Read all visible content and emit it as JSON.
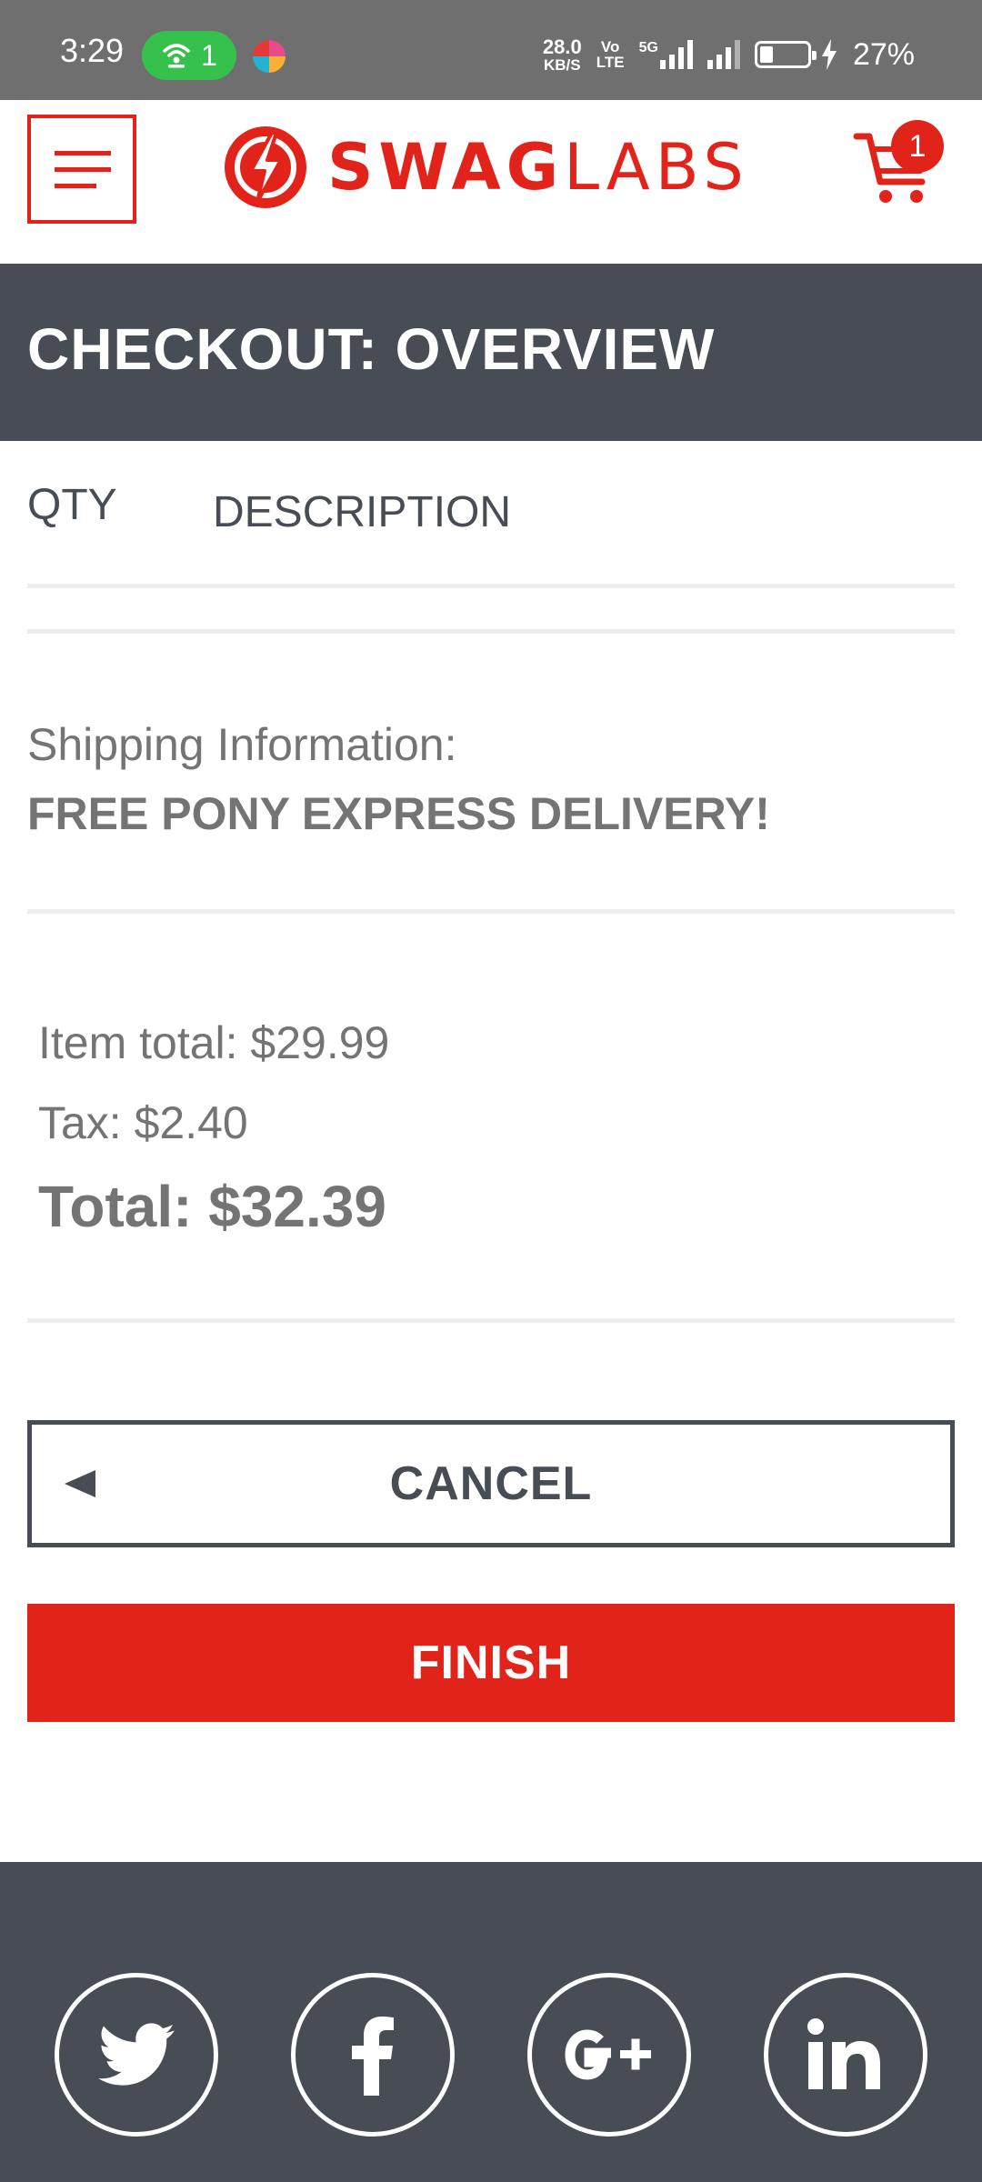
{
  "status_bar": {
    "time": "3:29",
    "hotspot_count": "1",
    "net_speed_value": "28.0",
    "net_speed_unit": "KB/S",
    "volte_top": "Vo",
    "volte_bottom": "LTE",
    "network_type": "5G",
    "battery_level": 0.27,
    "battery": "27%"
  },
  "header": {
    "logo_bold": "SWAG",
    "logo_light": "LABS",
    "cart_count": "1"
  },
  "page": {
    "title": "CHECKOUT: OVERVIEW"
  },
  "cart_list": {
    "qty_label": "QTY",
    "description_label": "DESCRIPTION"
  },
  "summary": {
    "shipping_label": "Shipping Information:",
    "shipping_value": "FREE PONY EXPRESS DELIVERY!",
    "item_total": "Item total: $29.99",
    "tax": "Tax: $2.40",
    "total": "Total: $32.39"
  },
  "buttons": {
    "cancel": "CANCEL",
    "finish": "FINISH"
  },
  "footer": {
    "social": [
      "twitter-icon",
      "facebook-icon",
      "google-plus-icon",
      "linkedin-icon"
    ]
  },
  "colors": {
    "brand_red": "#e2231a",
    "dark_slate": "#474c55",
    "text_gray": "#747474"
  }
}
